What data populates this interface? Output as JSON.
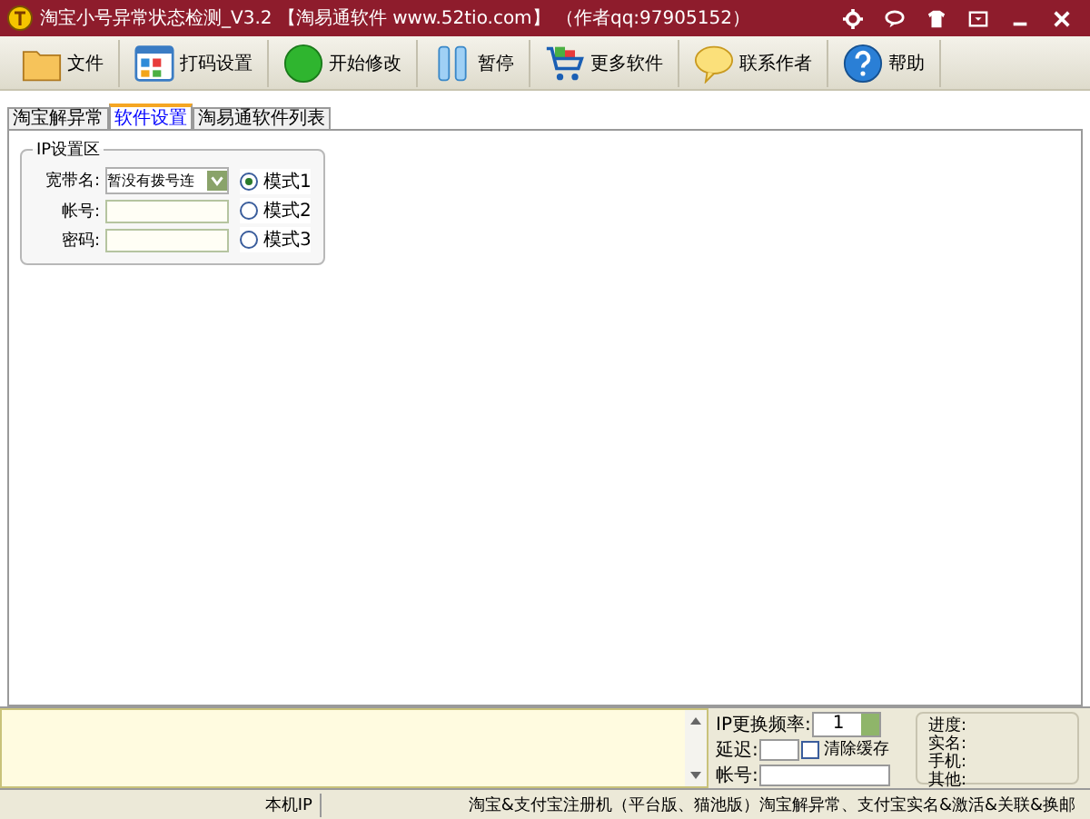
{
  "window": {
    "title": "淘宝小号异常状态检测_V3.2 【淘易通软件 www.52tio.com】 （作者qq:97905152）"
  },
  "toolbar": [
    {
      "kind": "folder",
      "label": "文件"
    },
    {
      "kind": "grid",
      "label": "打码设置"
    },
    {
      "kind": "start",
      "label": "开始修改"
    },
    {
      "kind": "pause",
      "label": "暂停"
    },
    {
      "kind": "cart",
      "label": "更多软件"
    },
    {
      "kind": "chat",
      "label": "联系作者"
    },
    {
      "kind": "help",
      "label": "帮助"
    }
  ],
  "tabs": [
    {
      "label": "淘宝解异常",
      "selected": false
    },
    {
      "label": "软件设置",
      "selected": true
    },
    {
      "label": "淘易通软件列表",
      "selected": false
    }
  ],
  "ip_group": {
    "title": "IP设置区",
    "broadband_label": "宽带名:",
    "broadband_value": "暂没有拨号连",
    "account_label": "帐号:",
    "password_label": "密码:",
    "modes": [
      {
        "label": "模式1",
        "selected": true
      },
      {
        "label": "模式2",
        "selected": false
      },
      {
        "label": "模式3",
        "selected": false
      }
    ]
  },
  "bottom": {
    "freq_label": "IP更换频率:",
    "freq_value": "1",
    "delay_label": "延迟:",
    "clear_cache": {
      "label": "清除缓存",
      "checked": false
    },
    "account_label": "帐号:",
    "info": [
      "进度:",
      "实名:",
      "手机:",
      "其他:"
    ]
  },
  "status_bar": [
    "本机IP",
    "淘宝&支付宝注册机（平台版、猫池版）淘宝解异常、支付宝实名&激活&关联&换邮"
  ]
}
